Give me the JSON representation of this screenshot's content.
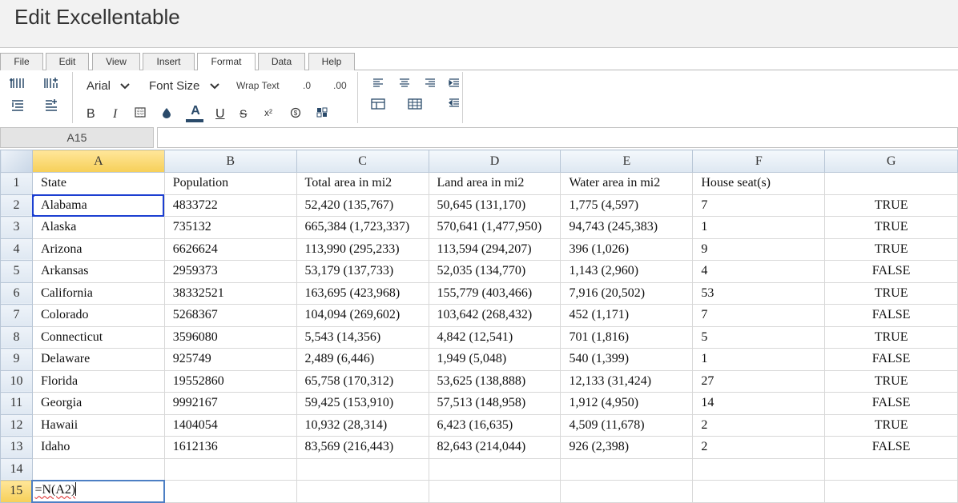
{
  "app": {
    "title": "Edit Excellentable"
  },
  "menu": {
    "tabs": [
      {
        "label": "File"
      },
      {
        "label": "Edit"
      },
      {
        "label": "View"
      },
      {
        "label": "Insert"
      },
      {
        "label": "Format",
        "active": true
      },
      {
        "label": "Data"
      },
      {
        "label": "Help"
      }
    ]
  },
  "toolbar": {
    "font_family": "Arial",
    "font_size": "Font Size",
    "wrap_text": "Wrap Text",
    "decimal_decrease": ".0",
    "decimal_increase": ".00",
    "bold": "B",
    "italic": "I",
    "font_color": "A",
    "underline": "U",
    "strikethrough": "S",
    "superscript": "x²",
    "icons": [
      "insert-column-left-icon",
      "insert-column-right-icon",
      "insert-row-above-icon",
      "insert-row-below-icon",
      "border-icon",
      "fill-color-icon",
      "currency-icon",
      "conditional-format-icon",
      "align-left-icon",
      "align-center-icon",
      "align-right-icon",
      "indent-icon",
      "merge-cells-icon",
      "table-icon",
      "outdent-icon"
    ],
    "accent_color": "#2a4a6a"
  },
  "formula_bar": {
    "cell_ref": "A15",
    "formula": ""
  },
  "grid": {
    "columns": [
      "A",
      "B",
      "C",
      "D",
      "E",
      "F",
      "G"
    ],
    "selected_column": "A",
    "selected_row": "15",
    "rows": [
      {
        "n": "1",
        "cells": [
          "State",
          "Population",
          "Total area in mi2",
          "Land area in mi2",
          "Water area in mi2",
          "House seat(s)",
          ""
        ]
      },
      {
        "n": "2",
        "cells": [
          "Alabama",
          "4833722",
          "52,420 (135,767)",
          "50,645 (131,170)",
          "1,775 (4,597)",
          "7",
          "TRUE"
        ]
      },
      {
        "n": "3",
        "cells": [
          "Alaska",
          "735132",
          "665,384 (1,723,337)",
          "570,641 (1,477,950)",
          "94,743 (245,383)",
          "1",
          "TRUE"
        ]
      },
      {
        "n": "4",
        "cells": [
          "Arizona",
          "6626624",
          "113,990 (295,233)",
          "113,594 (294,207)",
          "396 (1,026)",
          "9",
          "TRUE"
        ]
      },
      {
        "n": "5",
        "cells": [
          "Arkansas",
          "2959373",
          "53,179 (137,733)",
          "52,035 (134,770)",
          "1,143 (2,960)",
          "4",
          "FALSE"
        ]
      },
      {
        "n": "6",
        "cells": [
          "California",
          "38332521",
          "163,695 (423,968)",
          "155,779 (403,466)",
          "7,916 (20,502)",
          "53",
          "TRUE"
        ]
      },
      {
        "n": "7",
        "cells": [
          "Colorado",
          "5268367",
          "104,094 (269,602)",
          "103,642 (268,432)",
          "452 (1,171)",
          "7",
          "FALSE"
        ]
      },
      {
        "n": "8",
        "cells": [
          "Connecticut",
          "3596080",
          "5,543 (14,356)",
          "4,842 (12,541)",
          "701 (1,816)",
          "5",
          "TRUE"
        ]
      },
      {
        "n": "9",
        "cells": [
          "Delaware",
          "925749",
          "2,489 (6,446)",
          "1,949 (5,048)",
          "540 (1,399)",
          "1",
          "FALSE"
        ]
      },
      {
        "n": "10",
        "cells": [
          "Florida",
          "19552860",
          "65,758 (170,312)",
          "53,625 (138,888)",
          "12,133 (31,424)",
          "27",
          "TRUE"
        ]
      },
      {
        "n": "11",
        "cells": [
          "Georgia",
          "9992167",
          "59,425 (153,910)",
          "57,513 (148,958)",
          "1,912 (4,950)",
          "14",
          "FALSE"
        ]
      },
      {
        "n": "12",
        "cells": [
          "Hawaii",
          "1404054",
          "10,932 (28,314)",
          "6,423 (16,635)",
          "4,509 (11,678)",
          "2",
          "TRUE"
        ]
      },
      {
        "n": "13",
        "cells": [
          "Idaho",
          "1612136",
          "83,569 (216,443)",
          "82,643 (214,044)",
          "926 (2,398)",
          "2",
          "FALSE"
        ]
      },
      {
        "n": "14",
        "cells": [
          "",
          "",
          "",
          "",
          "",
          "",
          ""
        ]
      },
      {
        "n": "15",
        "cells": [
          "=N(A2)",
          "",
          "",
          "",
          "",
          "",
          ""
        ]
      }
    ],
    "selection_color": "#1c3fd1",
    "header_highlight_color": "#f6cf58"
  }
}
